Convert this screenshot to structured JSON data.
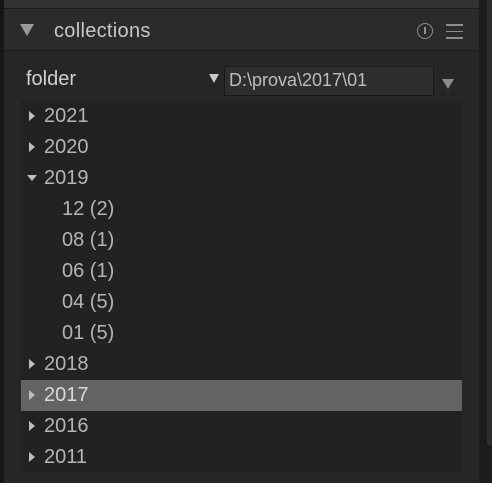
{
  "header": {
    "title": "collections",
    "icons": [
      "collapse-arrow-icon",
      "info-icon",
      "menu-icon"
    ]
  },
  "rule": {
    "property_label": "folder",
    "path_value": "D:\\prova\\2017\\01"
  },
  "tree": {
    "items": [
      {
        "label": "2021",
        "level": 0,
        "state": "collapsed",
        "selected": false
      },
      {
        "label": "2020",
        "level": 0,
        "state": "collapsed",
        "selected": false
      },
      {
        "label": "2019",
        "level": 0,
        "state": "expanded",
        "selected": false
      },
      {
        "label": "12 (2)",
        "level": 1,
        "state": "leaf",
        "selected": false
      },
      {
        "label": "08 (1)",
        "level": 1,
        "state": "leaf",
        "selected": false
      },
      {
        "label": "06 (1)",
        "level": 1,
        "state": "leaf",
        "selected": false
      },
      {
        "label": "04 (5)",
        "level": 1,
        "state": "leaf",
        "selected": false
      },
      {
        "label": "01 (5)",
        "level": 1,
        "state": "leaf",
        "selected": false
      },
      {
        "label": "2018",
        "level": 0,
        "state": "collapsed",
        "selected": false
      },
      {
        "label": "2017",
        "level": 0,
        "state": "collapsed",
        "selected": true
      },
      {
        "label": "2016",
        "level": 0,
        "state": "collapsed",
        "selected": false
      },
      {
        "label": "2011",
        "level": 0,
        "state": "collapsed",
        "selected": false
      }
    ]
  },
  "colors": {
    "panel_bg": "#262626",
    "tree_bg": "#222222",
    "selected_row_bg": "#636363",
    "text": "#b5b5b5"
  }
}
